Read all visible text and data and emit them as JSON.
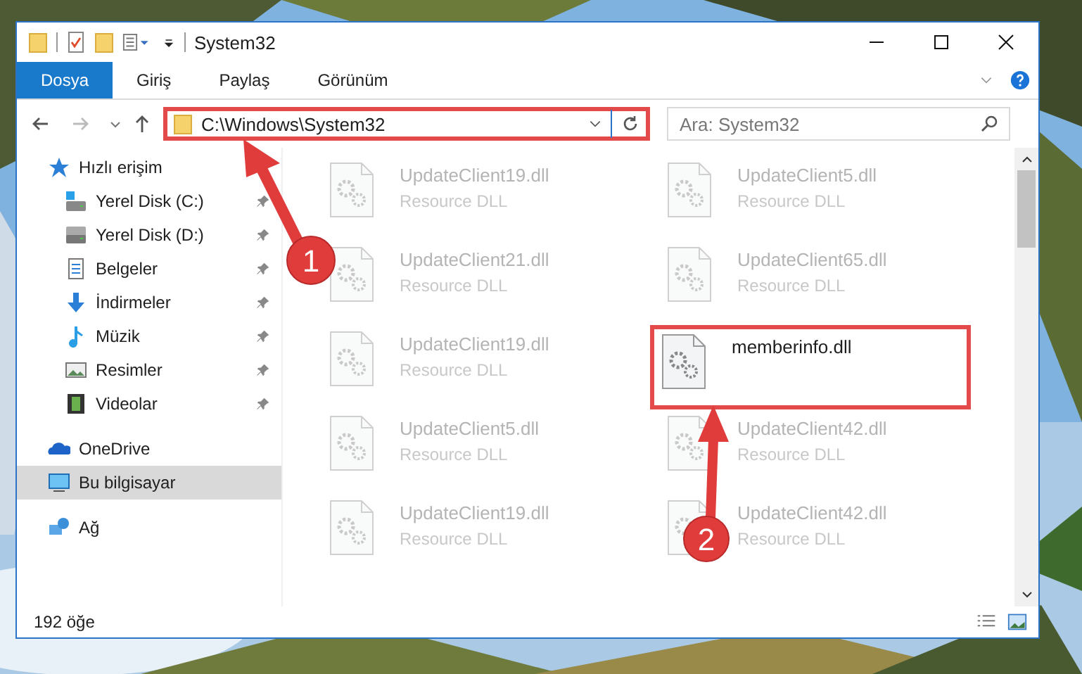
{
  "window": {
    "title": "System32"
  },
  "ribbon_tabs": [
    {
      "label": "Dosya",
      "selected": true
    },
    {
      "label": "Giriş",
      "selected": false
    },
    {
      "label": "Paylaş",
      "selected": false
    },
    {
      "label": "Görünüm",
      "selected": false
    }
  ],
  "address": {
    "path": "C:\\Windows\\System32",
    "highlighted": true
  },
  "search": {
    "placeholder": "Ara: System32"
  },
  "navigation": [
    {
      "label": "Hızlı erişim",
      "kind": "star",
      "selected": false,
      "children": [
        {
          "label": "Yerel Disk (C:)",
          "kind": "system-drive",
          "pinned": true,
          "selected": false
        },
        {
          "label": "Yerel Disk (D:)",
          "kind": "drive",
          "pinned": true,
          "selected": false
        },
        {
          "label": "Belgeler",
          "kind": "document",
          "pinned": true,
          "selected": false
        },
        {
          "label": "İndirmeler",
          "kind": "download",
          "pinned": true,
          "selected": false
        },
        {
          "label": "Müzik",
          "kind": "music",
          "pinned": true,
          "selected": false
        },
        {
          "label": "Resimler",
          "kind": "pictures",
          "pinned": true,
          "selected": false
        },
        {
          "label": "Videolar",
          "kind": "video",
          "pinned": true,
          "selected": false
        }
      ]
    },
    {
      "label": "OneDrive",
      "kind": "cloud",
      "selected": false
    },
    {
      "label": "Bu bilgisayar",
      "kind": "computer",
      "selected": true
    },
    {
      "label": "Ağ",
      "kind": "network",
      "selected": false
    }
  ],
  "files": [
    {
      "name": "UpdateClient19.dll",
      "type": "Resource DLL",
      "highlighted": false
    },
    {
      "name": "UpdateClient5.dll",
      "type": "Resource DLL",
      "highlighted": false
    },
    {
      "name": "UpdateClient21.dll",
      "type": "Resource DLL",
      "highlighted": false
    },
    {
      "name": "UpdateClient65.dll",
      "type": "Resource DLL",
      "highlighted": false
    },
    {
      "name": "UpdateClient19.dll",
      "type": "Resource DLL",
      "highlighted": false
    },
    {
      "name": "memberinfo.dll",
      "highlighted": true
    },
    {
      "name": "UpdateClient5.dll",
      "type": "Resource DLL",
      "highlighted": false
    },
    {
      "name": "UpdateClient42.dll",
      "type": "Resource DLL",
      "highlighted": false
    },
    {
      "name": "UpdateClient19.dll",
      "type": "Resource DLL",
      "highlighted": false
    },
    {
      "name": "UpdateClient42.dll",
      "type": "Resource DLL",
      "highlighted": false
    }
  ],
  "status_bar": {
    "item_count": "192 öğe"
  },
  "annotations": [
    {
      "label": "1"
    },
    {
      "label": "2"
    }
  ]
}
